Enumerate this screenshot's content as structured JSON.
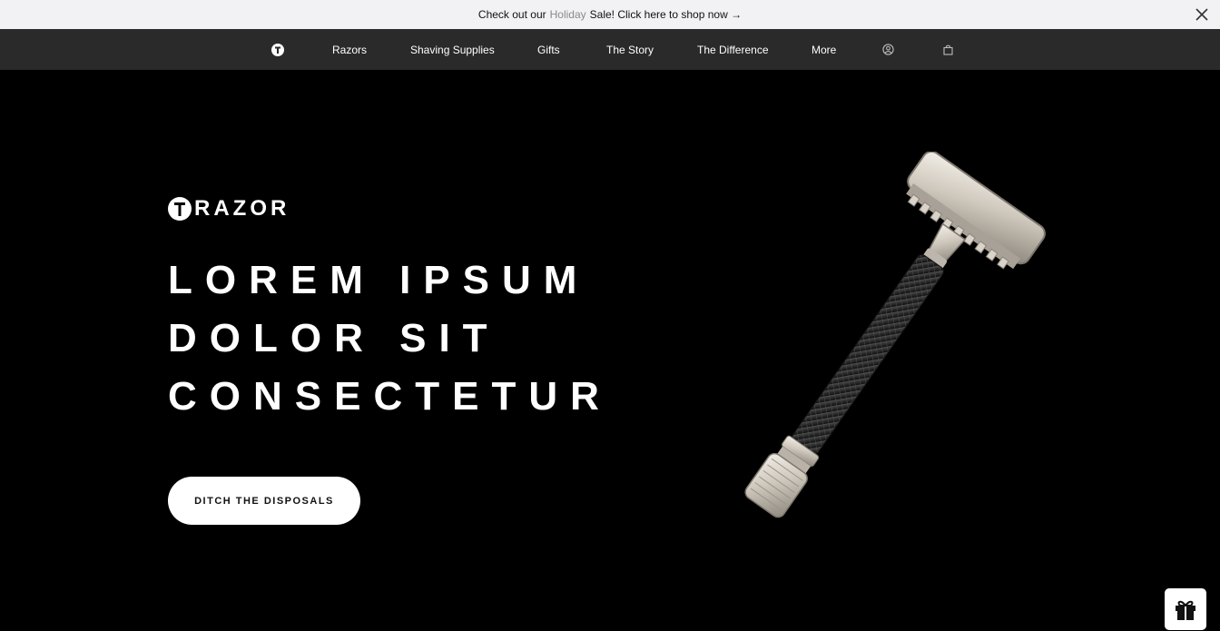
{
  "announcement": {
    "prefix": "Check out our",
    "highlight": "Holiday",
    "suffix": "Sale! Click here to shop now →"
  },
  "nav": {
    "items": [
      "Razors",
      "Shaving Supplies",
      "Gifts",
      "The Story",
      "The Difference",
      "More"
    ]
  },
  "hero": {
    "brand": "RAZOR",
    "headline": [
      "LOREM IPSUM",
      "DOLOR SIT",
      "CONSECTETUR"
    ],
    "cta": "DITCH THE DISPOSALS"
  },
  "icons": {
    "close": "close-icon",
    "logo": "logo-icon",
    "account": "account-icon",
    "cart": "cart-icon",
    "gift": "gift-icon"
  },
  "colors": {
    "announcement_bg": "#f2f2f4",
    "nav_bg": "#2a2a2b",
    "hero_bg": "#000000",
    "accent_text": "#8a8a8a"
  }
}
